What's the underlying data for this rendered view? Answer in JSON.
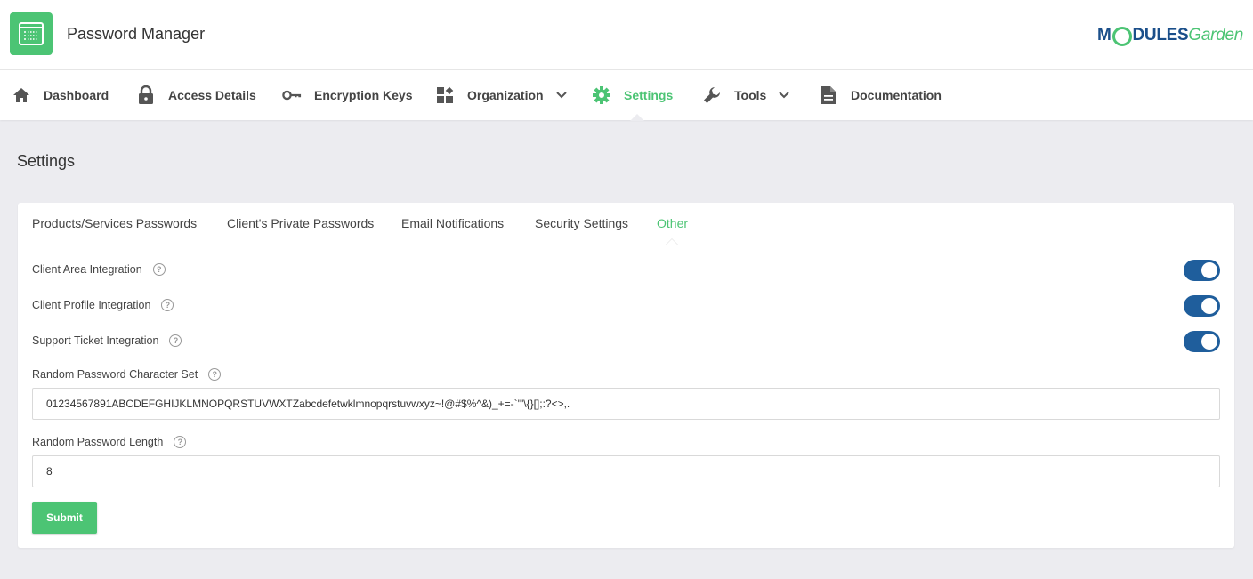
{
  "header": {
    "app_title": "Password Manager",
    "brand_part1": "M",
    "brand_part2": "DULES",
    "brand_part3": "Garden"
  },
  "nav": {
    "items": [
      {
        "label": "Dashboard",
        "icon": "home-icon"
      },
      {
        "label": "Access Details",
        "icon": "lock-icon"
      },
      {
        "label": "Encryption Keys",
        "icon": "key-icon"
      },
      {
        "label": "Organization",
        "icon": "widgets-icon",
        "dropdown": true
      },
      {
        "label": "Settings",
        "icon": "gear-icon",
        "active": true
      },
      {
        "label": "Tools",
        "icon": "wrench-icon",
        "dropdown": true
      },
      {
        "label": "Documentation",
        "icon": "document-icon"
      }
    ]
  },
  "page": {
    "title": "Settings"
  },
  "tabs": [
    {
      "label": "Products/Services Passwords"
    },
    {
      "label": "Client's Private Passwords"
    },
    {
      "label": "Email Notifications"
    },
    {
      "label": "Security Settings"
    },
    {
      "label": "Other",
      "active": true
    }
  ],
  "settings": {
    "client_area_integration": {
      "label": "Client Area Integration",
      "enabled": true
    },
    "client_profile_integration": {
      "label": "Client Profile Integration",
      "enabled": true
    },
    "support_ticket_integration": {
      "label": "Support Ticket Integration",
      "enabled": true
    },
    "charset": {
      "label": "Random Password Character Set",
      "value": "01234567891ABCDEFGHIJKLMNOPQRSTUVWXTZabcdefetwklmnopqrstuvwxyz~!@#$%^&)_+=-`'\"\\{}[];:?<>,."
    },
    "length": {
      "label": "Random Password Length",
      "value": "8"
    }
  },
  "actions": {
    "submit_label": "Submit"
  },
  "colors": {
    "accent": "#4cc474",
    "toggle_on": "#1f5e9c",
    "brand_blue": "#1b4f8a"
  }
}
